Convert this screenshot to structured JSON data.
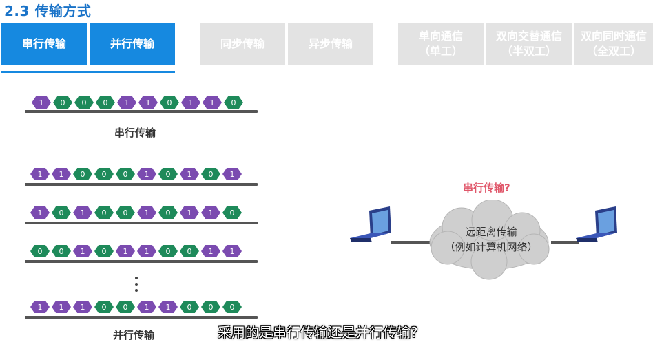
{
  "title": "2.3 传输方式",
  "tabs": [
    {
      "label": "串行传输",
      "active": true
    },
    {
      "label": "并行传输",
      "active": true
    },
    {
      "label": "同步传输",
      "active": false
    },
    {
      "label": "异步传输",
      "active": false
    },
    {
      "label": "单向通信",
      "sub": "（单工）",
      "active": false
    },
    {
      "label": "双向交替通信",
      "sub": "（半双工）",
      "active": false
    },
    {
      "label": "双向同时通信",
      "sub": "（全双工）",
      "active": false
    }
  ],
  "serial": {
    "bits": [
      "1",
      "0",
      "0",
      "0",
      "1",
      "1",
      "0",
      "1",
      "1",
      "0"
    ],
    "caption": "串行传输"
  },
  "parallel": {
    "rows": [
      [
        "1",
        "1",
        "0",
        "0",
        "0",
        "1",
        "0",
        "1",
        "0",
        "1"
      ],
      [
        "1",
        "0",
        "1",
        "0",
        "0",
        "1",
        "0",
        "1",
        "1",
        "0"
      ],
      [
        "0",
        "0",
        "1",
        "0",
        "1",
        "1",
        "0",
        "0",
        "1",
        "1"
      ],
      [
        "1",
        "1",
        "1",
        "0",
        "0",
        "1",
        "1",
        "0",
        "0",
        "0"
      ]
    ],
    "caption": "并行传输"
  },
  "network": {
    "question": "串行传输?",
    "cloud_line1": "远距离传输",
    "cloud_line2": "（例如计算机网络）"
  },
  "subtitle": "采用的是串行传输还是并行传输?",
  "colors": {
    "accent": "#1689e0",
    "bit_one": "#7b4bb0",
    "bit_zero": "#1e8a5a",
    "question": "#e0576a"
  }
}
